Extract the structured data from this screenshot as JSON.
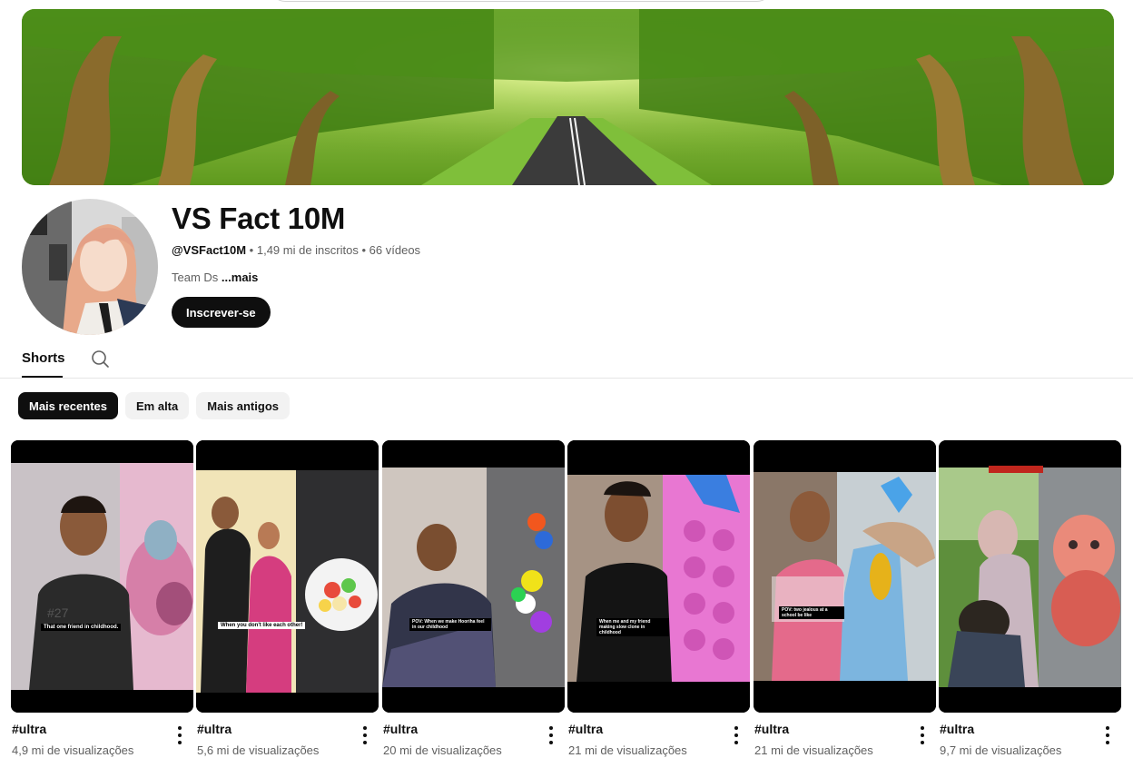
{
  "channel": {
    "name": "VS Fact 10M",
    "handle": "@VSFact10M",
    "subscribers": "1,49 mi de inscritos",
    "videos": "66 vídeos",
    "separator": "•",
    "description": "Team Ds",
    "more_label": "...mais",
    "subscribe_label": "Inscrever-se"
  },
  "tabs": {
    "shorts_label": "Shorts",
    "search_icon": "search-icon"
  },
  "filters": {
    "latest": "Mais recentes",
    "popular": "Em alta",
    "oldest": "Mais antigos"
  },
  "shorts": [
    {
      "title": "#ultra",
      "views": "4,9 mi de visualizações",
      "caption": "That one friend in childhood."
    },
    {
      "title": "#ultra",
      "views": "5,6 mi de visualizações",
      "caption": "When you don't like each other!"
    },
    {
      "title": "#ultra",
      "views": "20 mi de visualizações",
      "caption": "POV: When we make Hooriha feel in our childhood"
    },
    {
      "title": "#ultra",
      "views": "21 mi de visualizações",
      "caption": "When me and my friend making slow clone in childhood"
    },
    {
      "title": "#ultra",
      "views": "21 mi de visualizações",
      "caption": "POV: two jealous at a school be like"
    },
    {
      "title": "#ultra",
      "views": "9,7 mi de visualizações",
      "caption": ""
    }
  ],
  "colors": {
    "accent": "#0f0f0f",
    "secondary_text": "#606060",
    "chip_bg": "#f2f2f2"
  }
}
